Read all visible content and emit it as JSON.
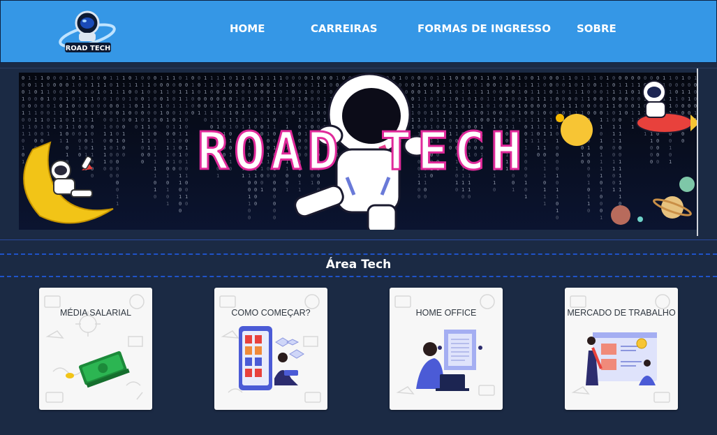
{
  "header": {
    "logo_text": "ROAD TECH",
    "nav": [
      {
        "label": "HOME"
      },
      {
        "label": "CARREIRAS"
      },
      {
        "label": "FORMAS DE INGRESSO"
      },
      {
        "label": "SOBRE"
      }
    ]
  },
  "banner": {
    "title": "ROAD TECH"
  },
  "section": {
    "title": "Área Tech",
    "cards": [
      {
        "title": "MÉDIA SALARIAL"
      },
      {
        "title": "COMO COMEÇAR?"
      },
      {
        "title": "HOME OFFICE"
      },
      {
        "title": "MERCADO DE TRABALHO"
      }
    ]
  },
  "colors": {
    "header_bg": "#3597e6",
    "page_bg": "#1b2a44",
    "accent_dash": "#1f53c9"
  }
}
